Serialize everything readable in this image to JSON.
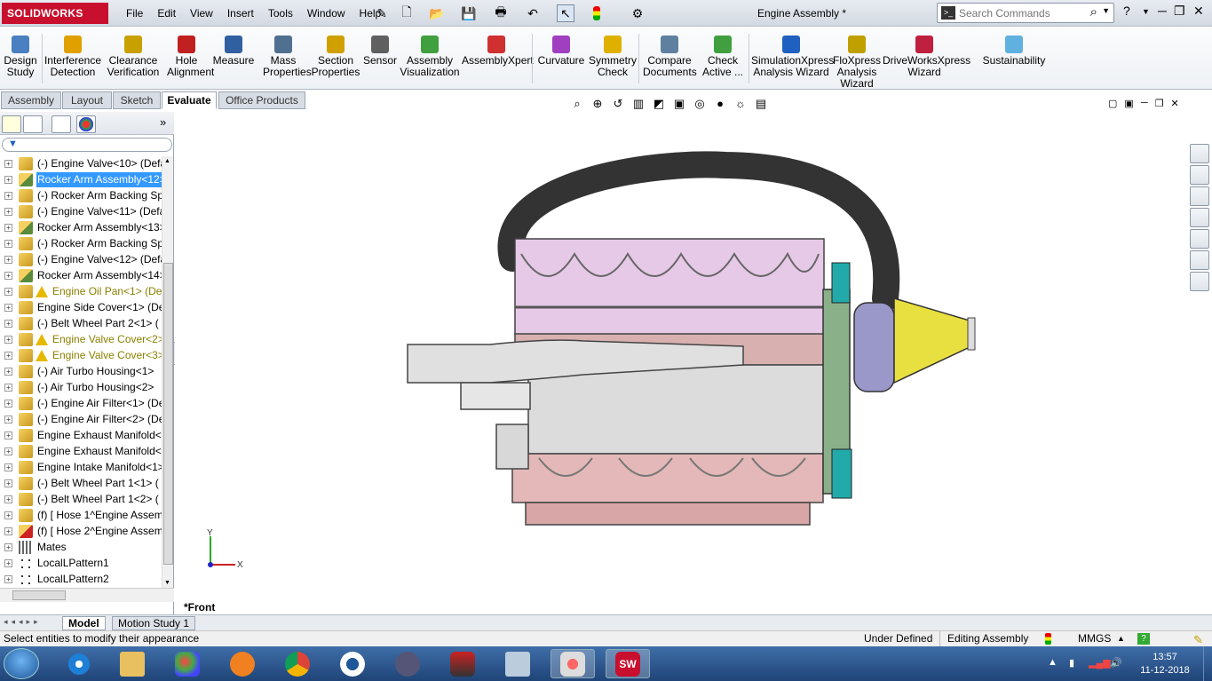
{
  "titlebar": {
    "logo": "SOLIDWORKS",
    "menu": [
      "File",
      "Edit",
      "View",
      "Insert",
      "Tools",
      "Window",
      "Help"
    ],
    "document_title": "Engine Assembly *",
    "search_placeholder": "Search Commands"
  },
  "ribbon": {
    "buttons": [
      {
        "id": "design-study",
        "label": "Design Study",
        "icon_color": "#4a7fc1"
      },
      {
        "id": "interference-detection",
        "label": "Interference Detection",
        "icon_color": "#e0a000"
      },
      {
        "id": "clearance-verification",
        "label": "Clearance Verification",
        "icon_color": "#c8a000"
      },
      {
        "id": "hole-alignment",
        "label": "Hole Alignment",
        "icon_color": "#c02020"
      },
      {
        "id": "measure",
        "label": "Measure",
        "icon_color": "#3060a0"
      },
      {
        "id": "mass-properties",
        "label": "Mass Properties",
        "icon_color": "#507090"
      },
      {
        "id": "section-properties",
        "label": "Section Properties",
        "icon_color": "#d0a000"
      },
      {
        "id": "sensor",
        "label": "Sensor",
        "icon_color": "#606060"
      },
      {
        "id": "assembly-visualization",
        "label": "Assembly Visualization",
        "icon_color": "#40a040"
      },
      {
        "id": "assemblyxpert",
        "label": "AssemblyXpert",
        "icon_color": "#d03030"
      },
      {
        "id": "curvature",
        "label": "Curvature",
        "icon_color": "#a040c0"
      },
      {
        "id": "symmetry-check",
        "label": "Symmetry Check",
        "icon_color": "#e0b000"
      },
      {
        "id": "compare-documents",
        "label": "Compare Documents",
        "icon_color": "#6080a0"
      },
      {
        "id": "check-active",
        "label": "Check Active ...",
        "icon_color": "#40a040"
      },
      {
        "id": "simulationxpress",
        "label": "SimulationXpress Analysis Wizard",
        "icon_color": "#2060c0"
      },
      {
        "id": "floxpress",
        "label": "FloXpress Analysis Wizard",
        "icon_color": "#c0a000"
      },
      {
        "id": "driveworksxpress",
        "label": "DriveWorksXpress Wizard",
        "icon_color": "#c02040"
      },
      {
        "id": "sustainability",
        "label": "Sustainability",
        "icon_color": "#60b0e0"
      }
    ]
  },
  "command_tabs": [
    {
      "label": "Assembly",
      "active": false
    },
    {
      "label": "Layout",
      "active": false
    },
    {
      "label": "Sketch",
      "active": false
    },
    {
      "label": "Evaluate",
      "active": true
    },
    {
      "label": "Office Products",
      "active": false
    }
  ],
  "feature_tree": [
    {
      "label": "(-) Engine Valve<10> (Defa",
      "type": "part",
      "state": "normal"
    },
    {
      "label": "Rocker Arm Assembly<12>",
      "type": "assembly",
      "state": "selected"
    },
    {
      "label": "(-) Rocker Arm Backing Sp",
      "type": "part",
      "state": "normal"
    },
    {
      "label": "(-) Engine Valve<11> (Defa",
      "type": "part",
      "state": "normal"
    },
    {
      "label": "Rocker Arm Assembly<13>",
      "type": "assembly",
      "state": "normal"
    },
    {
      "label": "(-) Rocker Arm Backing Sp",
      "type": "part",
      "state": "normal"
    },
    {
      "label": "(-) Engine Valve<12> (Defa",
      "type": "part",
      "state": "normal"
    },
    {
      "label": "Rocker Arm Assembly<14>",
      "type": "assembly",
      "state": "normal"
    },
    {
      "label": "Engine Oil Pan<1> (De",
      "type": "part",
      "state": "warning"
    },
    {
      "label": "Engine Side Cover<1> (De",
      "type": "part",
      "state": "normal"
    },
    {
      "label": "(-) Belt Wheel Part  2<1> (",
      "type": "part",
      "state": "normal"
    },
    {
      "label": "Engine Valve Cover<2>",
      "type": "part",
      "state": "warning"
    },
    {
      "label": "Engine Valve Cover<3>",
      "type": "part",
      "state": "warning"
    },
    {
      "label": "(-) Air Turbo Housing<1>",
      "type": "part",
      "state": "normal"
    },
    {
      "label": "(-) Air Turbo Housing<2>",
      "type": "part",
      "state": "normal"
    },
    {
      "label": "(-) Engine Air Filter<1> (De",
      "type": "part",
      "state": "normal"
    },
    {
      "label": "(-) Engine Air Filter<2> (De",
      "type": "part",
      "state": "normal"
    },
    {
      "label": "Engine Exhaust Manifold<",
      "type": "part",
      "state": "normal"
    },
    {
      "label": "Engine Exhaust Manifold<",
      "type": "part",
      "state": "normal"
    },
    {
      "label": "Engine Intake Manifold<1>",
      "type": "part",
      "state": "normal"
    },
    {
      "label": "(-) Belt Wheel Part  1<1> (",
      "type": "part",
      "state": "normal"
    },
    {
      "label": "(-) Belt Wheel Part  1<2> (",
      "type": "part",
      "state": "normal"
    },
    {
      "label": "(f) [ Hose 1^Engine Assem",
      "type": "part",
      "state": "normal"
    },
    {
      "label": "(f) [ Hose 2^Engine Assem",
      "type": "part-error",
      "state": "normal"
    },
    {
      "label": "Mates",
      "type": "mates",
      "state": "normal"
    },
    {
      "label": "LocalLPattern1",
      "type": "pattern",
      "state": "normal"
    },
    {
      "label": "LocalLPattern2",
      "type": "pattern",
      "state": "normal"
    }
  ],
  "viewport": {
    "orientation_label": "*Front",
    "triad_x": "X",
    "triad_y": "Y"
  },
  "bottom_tabs": [
    {
      "label": "Model",
      "active": true
    },
    {
      "label": "Motion Study 1",
      "active": false
    }
  ],
  "status_bar": {
    "message": "Select entities to modify their appearance",
    "definition": "Under Defined",
    "mode": "Editing Assembly",
    "units": "MMGS"
  },
  "taskbar": {
    "time": "13:57",
    "date": "11-12-2018"
  }
}
